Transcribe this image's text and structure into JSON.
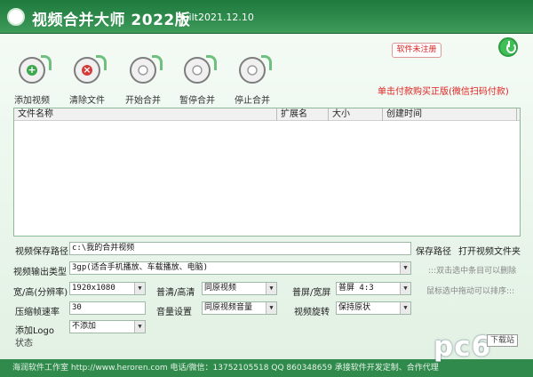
{
  "window": {
    "title": "视频合并大师 2022版",
    "build": "Built2021.12.10"
  },
  "toolbar": [
    {
      "label": "添加视频",
      "icon": "add-video-icon"
    },
    {
      "label": "清除文件",
      "icon": "clear-files-icon"
    },
    {
      "label": "开始合并",
      "icon": "start-merge-icon"
    },
    {
      "label": "暂停合并",
      "icon": "pause-merge-icon"
    },
    {
      "label": "停止合并",
      "icon": "stop-merge-icon"
    }
  ],
  "register": {
    "badge": "软件未注册",
    "buy_link": "单击付款购买正版(微信扫码付款)"
  },
  "filelist": {
    "columns": [
      "文件名称",
      "扩展名",
      "大小",
      "创建时间"
    ],
    "rows": []
  },
  "settings": {
    "save_path_label": "视频保存路径",
    "save_path_value": "c:\\我的合并视频",
    "save_path_button": "保存路径",
    "open_folder_button": "打开视频文件夹",
    "output_type_label": "视频输出类型",
    "output_type_value": "3gp(适合手机播放、车载播放、电脑)",
    "hint_dblclick": ":::双击选中条目可以删除",
    "resolution_label": "宽/高(分辨率)",
    "resolution_value": "1920x1080",
    "quality_label": "普清/高清",
    "quality_value": "同原视频",
    "aspect_label": "普屏/宽屏",
    "aspect_value": "普屏 4:3",
    "hint_drag": "鼠标选中拖动可以排序:::",
    "framerate_label": "压缩帧速率",
    "framerate_value": "30",
    "audio_label": "音量设置",
    "audio_value": "同原视频音量",
    "rotate_label": "视频旋转",
    "rotate_value": "保持原状",
    "logo_label": "添加Logo",
    "logo_value": "不添加"
  },
  "status": {
    "label": "状态"
  },
  "footer": {
    "text": "海润软件工作室 http://www.heroren.com   电话/微信：13752105518   QQ 860348659 承接软件开发定制、合作代理"
  },
  "watermark": {
    "logo_text": "pc6",
    "badge": "下载站"
  },
  "colors": {
    "title_bar": "#2e8b4c",
    "accent_red": "#dd2222",
    "power_green": "#3fbf56"
  }
}
